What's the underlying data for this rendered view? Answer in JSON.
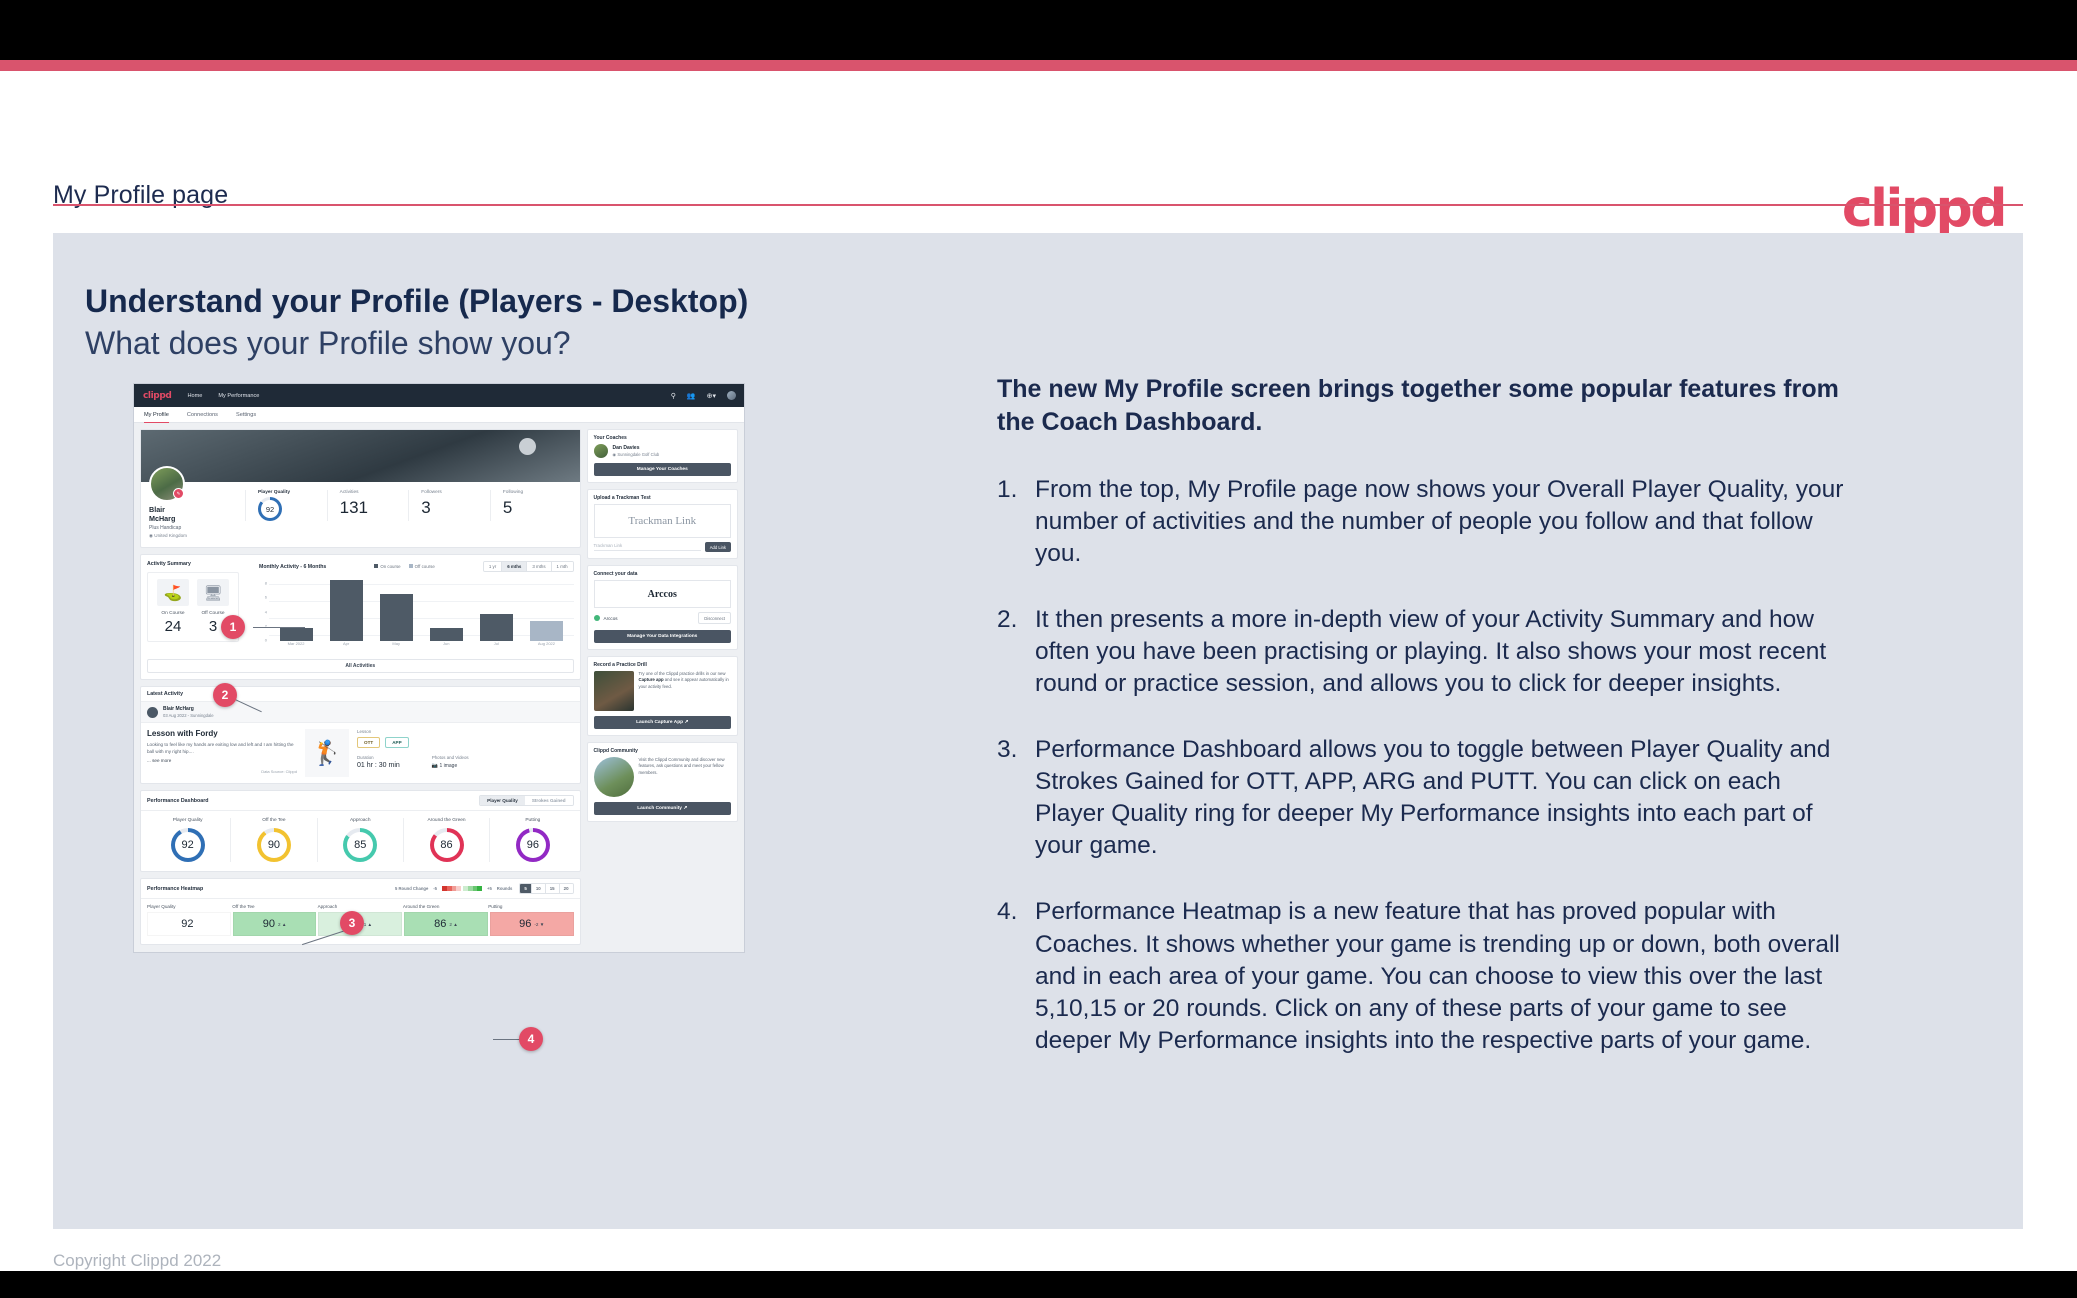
{
  "brand": {
    "logo": "clippd",
    "accent_color": "#d9546d",
    "dark_color": "#1f2a37"
  },
  "slide": {
    "header_title": "My Profile page",
    "heading": "Understand your Profile (Players - Desktop)",
    "subheading": "What does your Profile show you?",
    "copyright": "Copyright Clippd 2022"
  },
  "copy": {
    "lead": "The new My Profile screen brings together some popular features from the Coach Dashboard.",
    "items": [
      {
        "num": "1.",
        "text": "From the top, My Profile page now shows your Overall Player Quality, your number of activities and the number of people you follow and that follow you."
      },
      {
        "num": "2.",
        "text": "It then presents a more in-depth view of your Activity Summary and how often you have been practising or playing. It also shows your most recent round or practice session, and allows you to click for deeper insights."
      },
      {
        "num": "3.",
        "text": "Performance Dashboard allows you to toggle between Player Quality and Strokes Gained for OTT, APP, ARG and PUTT. You can click on each Player Quality ring for deeper My Performance insights into each part of your game."
      },
      {
        "num": "4.",
        "text": "Performance Heatmap is a new feature that has proved popular with Coaches. It shows whether your game is trending up or down, both overall and in each area of your game. You can choose to view this over the last 5,10,15 or 20 rounds. Click on any of these parts of your game to see deeper My Performance insights into the respective parts of your game."
      }
    ]
  },
  "callouts": [
    {
      "label": "1"
    },
    {
      "label": "2"
    },
    {
      "label": "3"
    },
    {
      "label": "4"
    }
  ],
  "app": {
    "nav": {
      "logo": "clippd",
      "links": [
        "Home",
        "My Performance"
      ],
      "icons": [
        "search-icon",
        "people-icon",
        "plus-circle-icon",
        "avatar-icon"
      ]
    },
    "tabs": [
      {
        "label": "My Profile",
        "active": true
      },
      {
        "label": "Connections",
        "active": false
      },
      {
        "label": "Settings",
        "active": false
      }
    ],
    "profile": {
      "name": "Blair McHarg",
      "handicap": "Plus Handicap",
      "location": "United Kingdom",
      "stats": [
        {
          "label": "Player Quality",
          "value": "92",
          "type": "ring"
        },
        {
          "label": "Activities",
          "value": "131"
        },
        {
          "label": "Followers",
          "value": "3"
        },
        {
          "label": "Following",
          "value": "5"
        }
      ]
    },
    "activity_summary": {
      "title": "Activity Summary",
      "tiles": [
        {
          "label": "On Course",
          "value": "24",
          "icon": "golf-flag-icon"
        },
        {
          "label": "Off Course",
          "value": "3",
          "icon": "monitor-icon"
        }
      ],
      "chart_title": "Monthly Activity - 6 Months",
      "legend": [
        {
          "label": "On course",
          "color": "#4e5a66"
        },
        {
          "label": "Off course",
          "color": "#a8b6c6"
        }
      ],
      "ranges": [
        {
          "label": "1 yr",
          "active": false
        },
        {
          "label": "6 mths",
          "active": true
        },
        {
          "label": "3 mths",
          "active": false
        },
        {
          "label": "1 mth",
          "active": false
        }
      ],
      "all_activities_button": "All Activities"
    },
    "latest_activity": {
      "title": "Latest Activity",
      "user": "Blair McHarg",
      "meta": "03 Aug 2022 - Sunningdale",
      "post_title": "Lesson with Fordy",
      "post_desc": "Looking to feel like my hands are exiting low and left and I am hitting the ball with my right hip....",
      "see_more": "... see more",
      "data_source": "Data Source: Clippd",
      "lesson_label": "Lesson",
      "chips": [
        "OTT",
        "APP"
      ],
      "duration_label": "Duration",
      "duration_value": "01 hr : 30 min",
      "photos_label": "Photos and Videos",
      "photos_value": "1 image"
    },
    "performance_dashboard": {
      "title": "Performance Dashboard",
      "toggle": [
        {
          "label": "Player Quality",
          "active": true
        },
        {
          "label": "Strokes Gained",
          "active": false
        }
      ],
      "rings": [
        {
          "label": "Player Quality",
          "value": "92",
          "color": "#2f6fb5",
          "pct": 92
        },
        {
          "label": "Off the Tee",
          "value": "90",
          "color": "#f2c230",
          "pct": 90
        },
        {
          "label": "Approach",
          "value": "85",
          "color": "#45c9ad",
          "pct": 85
        },
        {
          "label": "Around the Green",
          "value": "86",
          "color": "#e03356",
          "pct": 86
        },
        {
          "label": "Putting",
          "value": "96",
          "color": "#9229c4",
          "pct": 96
        }
      ]
    },
    "performance_heatmap": {
      "title": "Performance Heatmap",
      "legend_label": "5 Round Change",
      "legend_min": "-5",
      "legend_max": "+5",
      "rounds_label": "Rounds",
      "rounds_options": [
        {
          "label": "5",
          "active": true
        },
        {
          "label": "10",
          "active": false
        },
        {
          "label": "15",
          "active": false
        },
        {
          "label": "20",
          "active": false
        }
      ],
      "cells": [
        {
          "label": "Player Quality",
          "value": "92",
          "delta": "",
          "bg": "#ffffff"
        },
        {
          "label": "Off the Tee",
          "value": "90",
          "delta": "2 ▲",
          "bg": "#a9dfb4"
        },
        {
          "label": "Approach",
          "value": "85",
          "delta": "1 ▲",
          "bg": "#d9f0de"
        },
        {
          "label": "Around the Green",
          "value": "86",
          "delta": "2 ▲",
          "bg": "#a9dfb4"
        },
        {
          "label": "Putting",
          "value": "96",
          "delta": "-2 ▼",
          "bg": "#f4a8a5"
        }
      ]
    },
    "sidebar": {
      "coaches": {
        "title": "Your Coaches",
        "coach_name": "Dan Davies",
        "coach_club": "Sunningdale Golf Club",
        "button": "Manage Your Coaches"
      },
      "trackman": {
        "title": "Upload a Trackman Test",
        "box_label": "Trackman Link",
        "input_placeholder": "Trackman Link",
        "button": "Add Link"
      },
      "connect": {
        "title": "Connect your data",
        "provider": "Arccos",
        "status_label": "Arccos",
        "disconnect": "Disconnect",
        "button": "Manage Your Data Integrations"
      },
      "practice": {
        "title": "Record a Practice Drill",
        "text_a": "Try one of the Clippd practice drills in our new ",
        "text_b": "Capture app",
        "text_c": " and see it appear automatically in your activity feed.",
        "button": "Launch Capture App"
      },
      "community": {
        "title": "Clippd Community",
        "text": "Visit the Clippd Community and discover new features, ask questions and meet your fellow members.",
        "button": "Launch Community"
      }
    }
  },
  "chart_data": {
    "type": "bar",
    "title": "Monthly Activity - 6 Months",
    "categories": [
      "Mar 2022",
      "Apr",
      "May",
      "Jun",
      "Jul",
      "Aug 2022"
    ],
    "series": [
      {
        "name": "On course",
        "values": [
          2,
          9,
          7,
          2,
          4,
          0
        ],
        "color": "#4e5a66"
      },
      {
        "name": "Off course",
        "values": [
          0,
          0,
          0,
          0,
          0,
          3
        ],
        "color": "#a8b6c6"
      }
    ],
    "values": [
      2,
      9,
      7,
      2,
      4,
      3
    ],
    "yticks": [
      "0",
      "2",
      "4",
      "6",
      "8"
    ],
    "ylim": [
      0,
      9.5
    ],
    "xlabel": "",
    "ylabel": "",
    "grid": true,
    "legend_position": "top-right"
  }
}
